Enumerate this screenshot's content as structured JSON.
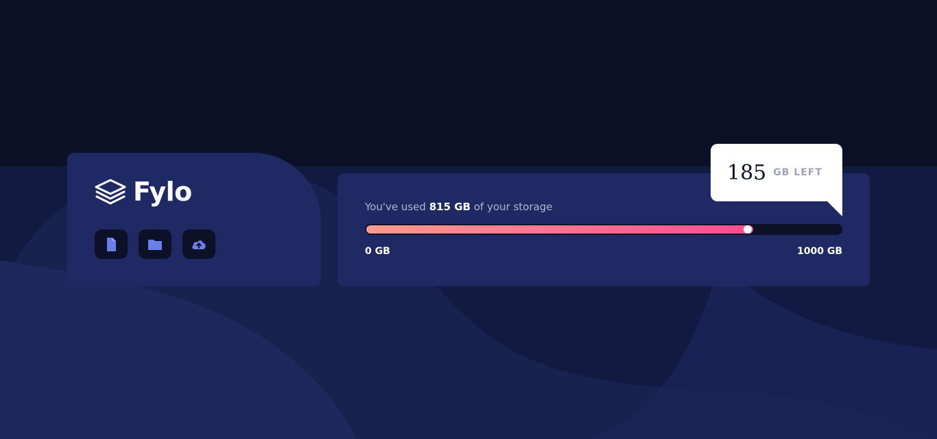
{
  "brand": {
    "name": "Fylo"
  },
  "toolbar": {
    "buttons": [
      {
        "icon": "document-icon"
      },
      {
        "icon": "folder-icon"
      },
      {
        "icon": "cloud-upload-icon"
      }
    ]
  },
  "storage": {
    "prefix": "You've used ",
    "used": "815 GB",
    "suffix": " of your storage",
    "min_label": "0 GB",
    "max_label": "1000 GB",
    "used_fraction": 0.815,
    "remaining": "185",
    "remaining_unit": "GB LEFT"
  },
  "colors": {
    "background": "#0d1127",
    "card": "#1f2a64",
    "icon": "#6b7fe8",
    "gradient_start": "#fd9a8e",
    "gradient_end": "#fd4c92"
  }
}
